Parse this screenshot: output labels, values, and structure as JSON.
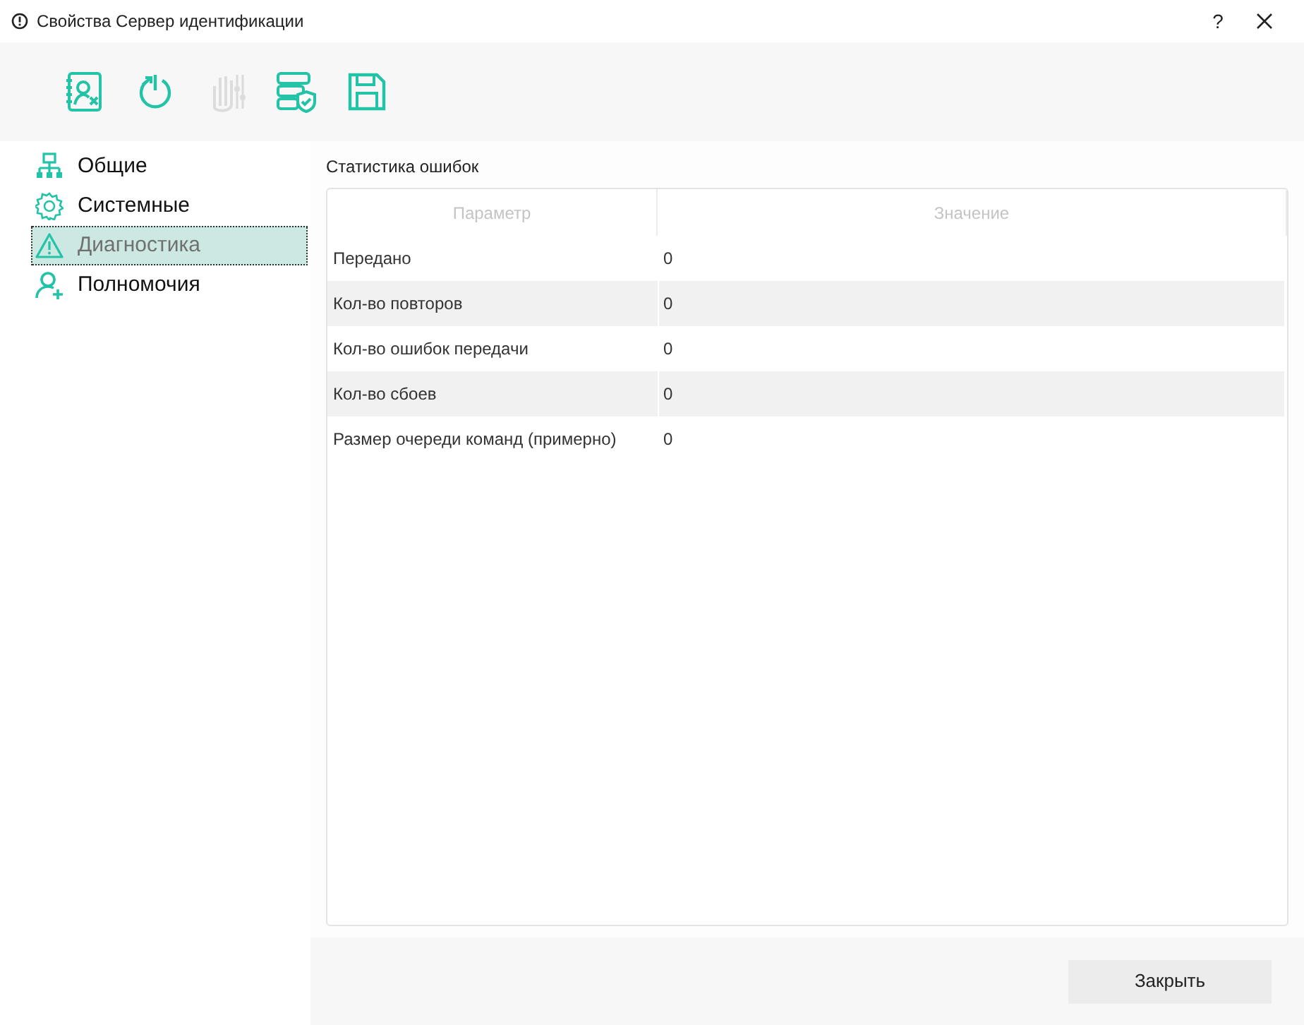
{
  "window": {
    "title": "Свойства Сервер идентификации",
    "help": "?"
  },
  "toolbar": [
    {
      "kind": "contact",
      "disabled": false
    },
    {
      "kind": "power",
      "disabled": false
    },
    {
      "kind": "hand",
      "disabled": true
    },
    {
      "kind": "server",
      "disabled": false
    },
    {
      "kind": "save",
      "disabled": false
    }
  ],
  "sidebar": {
    "items": [
      {
        "kind": "tree",
        "label": "Общие",
        "selected": false
      },
      {
        "kind": "gear",
        "label": "Системные",
        "selected": false
      },
      {
        "kind": "warning",
        "label": "Диагностика",
        "selected": true
      },
      {
        "kind": "user",
        "label": "Полномочия",
        "selected": false
      }
    ]
  },
  "section_title": "Статистика ошибок",
  "table": {
    "columns": [
      "Параметр",
      "Значение"
    ],
    "rows": [
      [
        "Передано",
        "0"
      ],
      [
        "Кол-во повторов",
        "0"
      ],
      [
        "Кол-во ошибок передачи",
        "0"
      ],
      [
        "Кол-во сбоев",
        "0"
      ],
      [
        "Размер очереди команд (примерно)",
        "0"
      ]
    ]
  },
  "buttons": [
    {
      "label": "Закрыть"
    }
  ]
}
